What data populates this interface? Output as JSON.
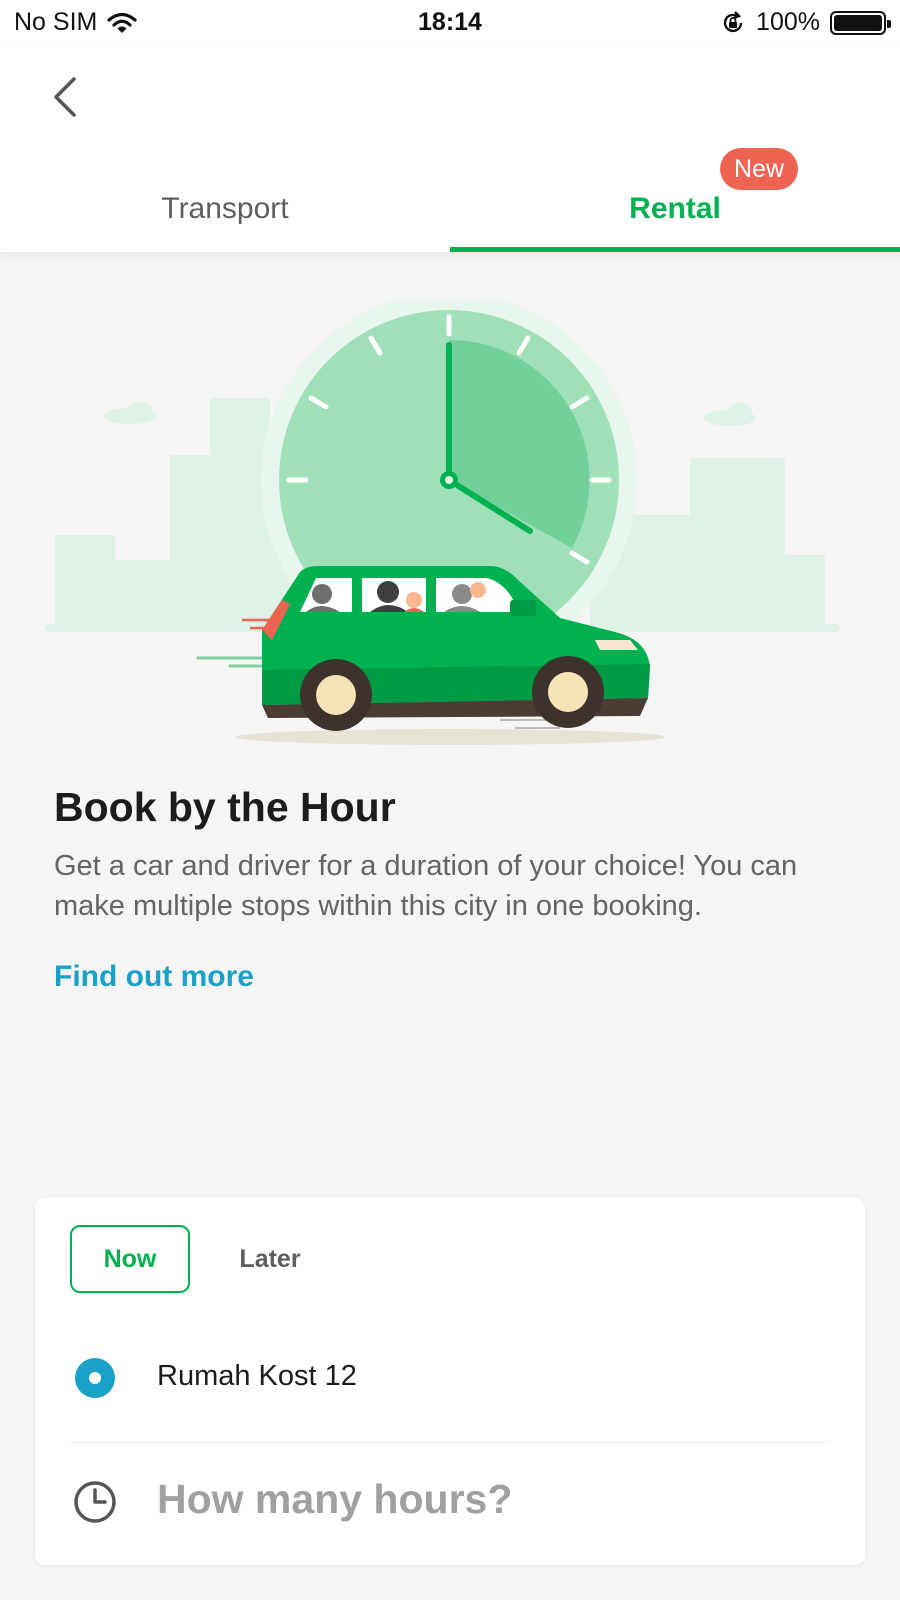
{
  "status_bar": {
    "carrier": "No SIM",
    "time": "18:14",
    "battery": "100%"
  },
  "tabs": [
    {
      "label": "Transport",
      "active": false
    },
    {
      "label": "Rental",
      "active": true,
      "badge": "New"
    }
  ],
  "content": {
    "title": "Book by the Hour",
    "description": "Get a car and driver for a duration of your choice! You can make multiple stops within this city in one booking.",
    "link": "Find out more"
  },
  "booking": {
    "timing": [
      {
        "label": "Now",
        "selected": true
      },
      {
        "label": "Later",
        "selected": false
      }
    ],
    "pickup_location": "Rumah Kost 12",
    "hours_placeholder": "How many hours?"
  },
  "colors": {
    "brand_green": "#00b14f",
    "link_blue": "#1ba0c8",
    "badge_red": "#ee6352"
  },
  "icons": [
    "back-arrow-icon",
    "wifi-icon",
    "rotation-lock-icon",
    "battery-icon",
    "location-dot-icon",
    "clock-icon"
  ]
}
